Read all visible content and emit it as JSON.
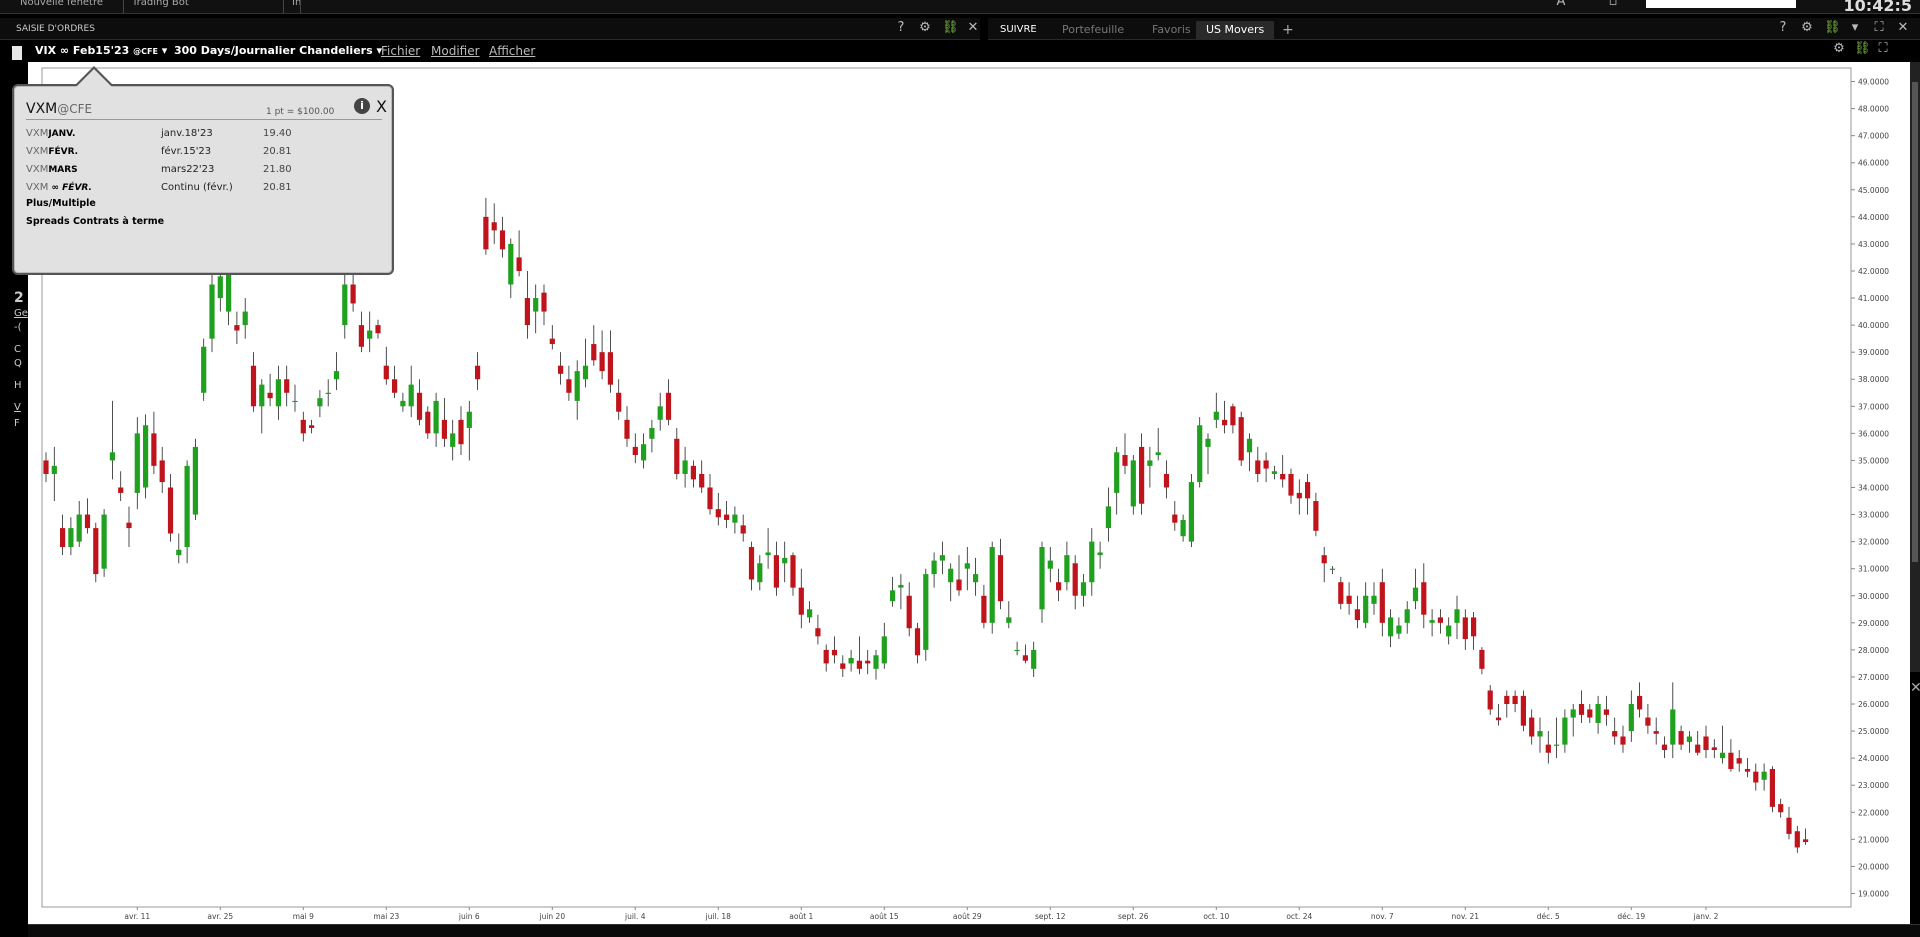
{
  "topbar": {
    "buttons": [
      "Nouvelle fenêtre",
      "Trading Bot",
      "Infos"
    ],
    "clock": "10:42:5"
  },
  "order_panel": {
    "title": "SAISIE D'ORDRES"
  },
  "tabs": [
    {
      "label": "SUIVRE",
      "active": false
    },
    {
      "label": "Portefeuille",
      "active": false
    },
    {
      "label": "Favoris",
      "active": false
    },
    {
      "label": "US Movers",
      "active": true
    }
  ],
  "chart_toolbar": {
    "symbol": "VIX ∞ Feb15'23",
    "exchange": "@CFE",
    "period": "300 Days/Journalier Chandeliers",
    "menus": [
      "Fichier",
      "Modifier",
      "Afficher"
    ]
  },
  "popup": {
    "title": "VXM",
    "exchange": "@CFE",
    "point_value": "1 pt = $100.00",
    "rows": [
      {
        "root": "VXM",
        "month": "JANV.",
        "expiry": "janv.18'23",
        "price": "19.40"
      },
      {
        "root": "VXM",
        "month": "FÉVR.",
        "expiry": "févr.15'23",
        "price": "20.81"
      },
      {
        "root": "VXM",
        "month": "MARS",
        "expiry": "mars22'23",
        "price": "21.80"
      },
      {
        "root": "VXM",
        "month": "∞ FÉVR.",
        "expiry": "Continu (févr.)",
        "price": "20.81"
      }
    ],
    "links": [
      "Plus/Multiple",
      "Spreads Contrats à terme"
    ]
  },
  "left_labels": [
    "2",
    "Ge",
    "-(",
    "C",
    "Q",
    "H",
    "V",
    "F"
  ],
  "chart_data": {
    "type": "candlestick",
    "y_ticks": [
      "49.0000",
      "48.0000",
      "47.0000",
      "46.0000",
      "45.0000",
      "44.0000",
      "43.0000",
      "42.0000",
      "41.0000",
      "40.0000",
      "39.0000",
      "38.0000",
      "37.0000",
      "36.0000",
      "35.0000",
      "34.0000",
      "33.0000",
      "32.0000",
      "31.0000",
      "30.0000",
      "29.0000",
      "28.0000",
      "27.0000",
      "26.0000",
      "25.0000",
      "24.0000",
      "23.0000",
      "22.0000",
      "21.0000",
      "20.0000",
      "19.0000"
    ],
    "ylim": [
      18.5,
      49.5
    ],
    "x_labels": [
      {
        "label": "avr. 11",
        "index": 11
      },
      {
        "label": "avr. 25",
        "index": 21
      },
      {
        "label": "mai 9",
        "index": 31
      },
      {
        "label": "mai 23",
        "index": 41
      },
      {
        "label": "juin 6",
        "index": 51
      },
      {
        "label": "juin 20",
        "index": 61
      },
      {
        "label": "juil. 4",
        "index": 71
      },
      {
        "label": "juil. 18",
        "index": 81
      },
      {
        "label": "août 1",
        "index": 91
      },
      {
        "label": "août 15",
        "index": 101
      },
      {
        "label": "août 29",
        "index": 111
      },
      {
        "label": "sept. 12",
        "index": 121
      },
      {
        "label": "sept. 26",
        "index": 131
      },
      {
        "label": "oct. 10",
        "index": 141
      },
      {
        "label": "oct. 24",
        "index": 151
      },
      {
        "label": "nov. 7",
        "index": 161
      },
      {
        "label": "nov. 21",
        "index": 171
      },
      {
        "label": "déc. 5",
        "index": 181
      },
      {
        "label": "déc. 19",
        "index": 191
      },
      {
        "label": "janv. 2",
        "index": 200
      }
    ],
    "candles": [
      [
        35.0,
        35.3,
        34.2,
        34.5
      ],
      [
        34.5,
        35.5,
        33.5,
        34.8
      ],
      [
        32.5,
        33.0,
        31.5,
        31.8
      ],
      [
        31.8,
        32.9,
        31.5,
        32.5
      ],
      [
        32.0,
        33.5,
        31.8,
        33.0
      ],
      [
        33.0,
        33.6,
        32.3,
        32.5
      ],
      [
        32.5,
        32.7,
        30.5,
        30.8
      ],
      [
        31.0,
        33.2,
        30.7,
        33.0
      ],
      [
        35.0,
        37.2,
        34.3,
        35.3
      ],
      [
        34.0,
        34.6,
        33.5,
        33.8
      ],
      [
        32.7,
        33.3,
        31.8,
        32.5
      ],
      [
        33.8,
        36.6,
        33.2,
        36.0
      ],
      [
        34.0,
        36.7,
        33.6,
        36.3
      ],
      [
        36.0,
        36.8,
        34.5,
        34.8
      ],
      [
        35.0,
        35.5,
        33.8,
        34.2
      ],
      [
        34.0,
        34.5,
        32.0,
        32.3
      ],
      [
        31.5,
        32.3,
        31.2,
        31.7
      ],
      [
        31.8,
        35.0,
        31.2,
        34.8
      ],
      [
        33.0,
        35.8,
        32.8,
        35.5
      ],
      [
        37.5,
        39.5,
        37.2,
        39.2
      ],
      [
        39.5,
        42.0,
        39.0,
        41.5
      ],
      [
        41.0,
        42.2,
        40.5,
        41.8
      ],
      [
        40.5,
        42.5,
        40.0,
        42.0
      ],
      [
        40.0,
        40.5,
        39.3,
        39.8
      ],
      [
        40.0,
        41.0,
        39.5,
        40.5
      ],
      [
        38.5,
        39.0,
        36.8,
        37.0
      ],
      [
        37.0,
        38.0,
        36.0,
        37.8
      ],
      [
        37.5,
        38.2,
        37.0,
        37.3
      ],
      [
        37.0,
        38.5,
        36.5,
        38.0
      ],
      [
        38.0,
        38.5,
        37.0,
        37.5
      ],
      [
        37.2,
        37.8,
        36.8,
        37.2
      ],
      [
        36.5,
        36.8,
        35.7,
        36.0
      ],
      [
        36.3,
        36.5,
        36.0,
        36.2
      ],
      [
        37.0,
        37.6,
        36.6,
        37.3
      ],
      [
        37.5,
        38.0,
        37.0,
        37.5
      ],
      [
        38.0,
        39.0,
        37.6,
        38.3
      ],
      [
        40.0,
        42.0,
        39.5,
        41.5
      ],
      [
        41.5,
        42.5,
        40.5,
        40.8
      ],
      [
        40.0,
        40.5,
        39.0,
        39.2
      ],
      [
        39.5,
        40.5,
        39.0,
        39.8
      ],
      [
        40.0,
        40.2,
        39.5,
        39.7
      ],
      [
        38.5,
        39.2,
        37.8,
        38.0
      ],
      [
        38.0,
        38.5,
        37.3,
        37.5
      ],
      [
        37.0,
        37.5,
        36.8,
        37.2
      ],
      [
        37.0,
        38.5,
        36.6,
        37.8
      ],
      [
        37.5,
        38.0,
        36.3,
        36.5
      ],
      [
        36.8,
        37.0,
        35.8,
        36.0
      ],
      [
        36.0,
        37.5,
        35.5,
        37.2
      ],
      [
        36.5,
        37.3,
        35.5,
        35.8
      ],
      [
        35.5,
        36.5,
        35.0,
        36.0
      ],
      [
        36.5,
        37.0,
        35.2,
        35.6
      ],
      [
        36.2,
        37.2,
        35.0,
        36.8
      ],
      [
        38.5,
        39.0,
        37.6,
        38.0
      ],
      [
        44.0,
        44.7,
        42.6,
        42.8
      ],
      [
        43.8,
        44.5,
        43.0,
        43.5
      ],
      [
        43.5,
        44.0,
        42.5,
        42.8
      ],
      [
        41.5,
        43.2,
        41.0,
        43.0
      ],
      [
        42.5,
        43.5,
        41.8,
        42.0
      ],
      [
        41.0,
        42.0,
        39.5,
        40.0
      ],
      [
        40.5,
        41.5,
        39.7,
        41.0
      ],
      [
        41.2,
        41.5,
        40.0,
        40.5
      ],
      [
        39.5,
        40.0,
        39.1,
        39.3
      ],
      [
        38.5,
        39.0,
        37.8,
        38.2
      ],
      [
        38.0,
        38.5,
        37.2,
        37.5
      ],
      [
        37.2,
        38.7,
        36.5,
        38.3
      ],
      [
        38.0,
        39.5,
        37.7,
        38.5
      ],
      [
        39.3,
        40.0,
        38.5,
        38.7
      ],
      [
        39.0,
        39.8,
        38.0,
        38.3
      ],
      [
        39.0,
        39.8,
        37.5,
        37.8
      ],
      [
        37.5,
        38.0,
        36.5,
        36.8
      ],
      [
        36.5,
        37.0,
        35.5,
        35.8
      ],
      [
        35.5,
        36.0,
        34.9,
        35.2
      ],
      [
        35.0,
        36.0,
        34.7,
        35.6
      ],
      [
        35.8,
        36.5,
        35.3,
        36.2
      ],
      [
        36.5,
        37.5,
        36.1,
        37.0
      ],
      [
        37.5,
        38.0,
        36.3,
        36.5
      ],
      [
        35.8,
        36.2,
        34.3,
        34.5
      ],
      [
        34.5,
        35.5,
        34.0,
        35.0
      ],
      [
        34.8,
        35.0,
        34.0,
        34.3
      ],
      [
        34.5,
        35.0,
        33.8,
        34.0
      ],
      [
        34.0,
        34.5,
        33.0,
        33.2
      ],
      [
        33.2,
        33.8,
        32.6,
        32.9
      ],
      [
        33.0,
        33.5,
        32.5,
        32.8
      ],
      [
        32.7,
        33.3,
        32.3,
        33.0
      ],
      [
        32.6,
        33.0,
        32.0,
        32.3
      ],
      [
        31.8,
        32.0,
        30.2,
        30.6
      ],
      [
        30.5,
        31.5,
        30.2,
        31.2
      ],
      [
        31.5,
        32.5,
        31.0,
        31.6
      ],
      [
        31.5,
        32.0,
        30.0,
        30.3
      ],
      [
        31.2,
        32.0,
        30.5,
        31.4
      ],
      [
        31.5,
        31.6,
        30.0,
        30.3
      ],
      [
        30.3,
        31.0,
        28.8,
        29.3
      ],
      [
        29.2,
        29.8,
        29.0,
        29.5
      ],
      [
        28.8,
        29.3,
        28.2,
        28.5
      ],
      [
        28.0,
        28.2,
        27.2,
        27.5
      ],
      [
        28.0,
        28.5,
        27.5,
        27.8
      ],
      [
        27.5,
        27.8,
        27.0,
        27.3
      ],
      [
        27.5,
        28.0,
        27.2,
        27.7
      ],
      [
        27.6,
        28.5,
        27.1,
        27.3
      ],
      [
        27.6,
        28.0,
        27.1,
        27.5
      ],
      [
        27.3,
        28.0,
        26.9,
        27.8
      ],
      [
        27.5,
        29.0,
        27.3,
        28.5
      ],
      [
        29.8,
        30.7,
        29.6,
        30.2
      ],
      [
        30.3,
        30.8,
        29.5,
        30.4
      ],
      [
        30.0,
        30.5,
        28.5,
        28.8
      ],
      [
        28.8,
        29.0,
        27.5,
        27.8
      ],
      [
        28.0,
        31.0,
        27.6,
        30.8
      ],
      [
        30.8,
        31.6,
        30.3,
        31.3
      ],
      [
        31.3,
        32.0,
        30.8,
        31.5
      ],
      [
        30.5,
        31.2,
        29.8,
        31.0
      ],
      [
        30.6,
        31.5,
        30.0,
        30.2
      ],
      [
        31.0,
        31.8,
        30.2,
        31.2
      ],
      [
        30.5,
        31.4,
        30.0,
        30.8
      ],
      [
        30.0,
        30.4,
        28.8,
        29.0
      ],
      [
        29.0,
        32.0,
        28.6,
        31.8
      ],
      [
        31.5,
        32.1,
        29.5,
        29.8
      ],
      [
        29.0,
        29.8,
        28.8,
        29.2
      ],
      [
        28.0,
        28.3,
        27.8,
        28.0
      ],
      [
        27.8,
        28.2,
        27.5,
        27.6
      ],
      [
        27.3,
        28.3,
        27.0,
        28.0
      ],
      [
        29.5,
        32.0,
        29.0,
        31.8
      ],
      [
        31.0,
        31.8,
        30.5,
        31.3
      ],
      [
        30.5,
        31.0,
        29.8,
        30.2
      ],
      [
        30.5,
        32.0,
        30.2,
        31.5
      ],
      [
        31.2,
        31.5,
        29.5,
        30.0
      ],
      [
        30.0,
        30.8,
        29.6,
        30.5
      ],
      [
        30.5,
        32.5,
        30.0,
        32.0
      ],
      [
        31.5,
        32.0,
        31.0,
        31.6
      ],
      [
        32.5,
        34.0,
        32.0,
        33.3
      ],
      [
        33.8,
        35.5,
        33.0,
        35.3
      ],
      [
        35.2,
        36.0,
        34.5,
        34.8
      ],
      [
        33.3,
        35.2,
        33.0,
        35.0
      ],
      [
        35.5,
        36.0,
        33.0,
        33.4
      ],
      [
        34.8,
        35.5,
        34.0,
        35.0
      ],
      [
        35.2,
        36.2,
        35.0,
        35.3
      ],
      [
        34.5,
        35.0,
        33.6,
        34.0
      ],
      [
        33.0,
        33.5,
        32.4,
        32.7
      ],
      [
        32.2,
        33.0,
        32.0,
        32.8
      ],
      [
        32.0,
        34.5,
        31.8,
        34.2
      ],
      [
        34.2,
        36.6,
        34.0,
        36.3
      ],
      [
        35.5,
        36.0,
        34.5,
        35.8
      ],
      [
        36.5,
        37.5,
        36.2,
        36.8
      ],
      [
        36.5,
        37.2,
        36.0,
        36.3
      ],
      [
        37.0,
        37.1,
        36.0,
        36.3
      ],
      [
        36.6,
        36.8,
        34.8,
        35.0
      ],
      [
        35.3,
        36.0,
        34.6,
        35.8
      ],
      [
        35.0,
        35.5,
        34.2,
        34.5
      ],
      [
        35.0,
        35.3,
        34.2,
        34.7
      ],
      [
        34.5,
        34.8,
        34.3,
        34.6
      ],
      [
        34.5,
        35.2,
        34.0,
        34.3
      ],
      [
        34.5,
        34.7,
        33.4,
        33.7
      ],
      [
        33.8,
        34.3,
        33.0,
        33.6
      ],
      [
        34.2,
        34.5,
        33.0,
        33.6
      ],
      [
        33.5,
        33.8,
        32.2,
        32.4
      ],
      [
        31.5,
        31.8,
        30.5,
        31.2
      ],
      [
        31.0,
        31.1,
        30.8,
        31.0
      ],
      [
        30.5,
        30.7,
        29.5,
        29.7
      ],
      [
        30.0,
        30.5,
        29.3,
        29.7
      ],
      [
        29.5,
        30.0,
        28.8,
        29.1
      ],
      [
        29.0,
        30.5,
        28.8,
        30.0
      ],
      [
        29.7,
        30.5,
        29.3,
        30.0
      ],
      [
        30.5,
        31.0,
        28.5,
        29.0
      ],
      [
        28.5,
        29.5,
        28.1,
        29.2
      ],
      [
        28.6,
        29.2,
        28.4,
        28.9
      ],
      [
        29.0,
        29.8,
        28.6,
        29.5
      ],
      [
        29.8,
        31.0,
        29.5,
        30.3
      ],
      [
        30.5,
        31.2,
        28.8,
        29.3
      ],
      [
        29.0,
        29.5,
        28.5,
        29.1
      ],
      [
        29.2,
        29.5,
        28.6,
        29.0
      ],
      [
        28.5,
        29.2,
        28.2,
        28.9
      ],
      [
        29.0,
        30.0,
        28.4,
        29.5
      ],
      [
        29.2,
        29.5,
        28.0,
        28.4
      ],
      [
        29.2,
        29.4,
        28.0,
        28.5
      ],
      [
        28.0,
        28.1,
        27.1,
        27.3
      ],
      [
        26.5,
        26.7,
        25.6,
        25.8
      ],
      [
        25.5,
        26.0,
        25.2,
        25.4
      ],
      [
        26.3,
        26.5,
        25.5,
        26.0
      ],
      [
        26.3,
        26.5,
        25.7,
        26.0
      ],
      [
        26.3,
        26.5,
        25.0,
        25.2
      ],
      [
        25.5,
        25.8,
        24.5,
        24.8
      ],
      [
        24.8,
        25.5,
        24.2,
        25.0
      ],
      [
        24.5,
        25.0,
        23.8,
        24.2
      ],
      [
        24.5,
        25.5,
        24.0,
        24.5
      ],
      [
        24.5,
        25.8,
        24.2,
        25.5
      ],
      [
        25.5,
        26.0,
        24.8,
        25.8
      ],
      [
        26.0,
        26.5,
        25.3,
        25.6
      ],
      [
        25.8,
        26.0,
        25.3,
        25.5
      ],
      [
        25.3,
        26.3,
        24.9,
        26.0
      ],
      [
        25.8,
        26.3,
        25.2,
        25.6
      ],
      [
        25.0,
        25.5,
        24.5,
        24.8
      ],
      [
        24.8,
        25.2,
        24.2,
        24.5
      ],
      [
        25.0,
        26.5,
        24.6,
        26.0
      ],
      [
        26.3,
        26.8,
        25.5,
        25.8
      ],
      [
        25.5,
        26.0,
        24.9,
        25.2
      ],
      [
        25.0,
        25.5,
        24.5,
        24.9
      ],
      [
        24.5,
        24.8,
        24.0,
        24.3
      ],
      [
        24.5,
        26.8,
        24.0,
        25.8
      ],
      [
        25.0,
        25.2,
        24.3,
        24.5
      ],
      [
        24.6,
        25.0,
        24.2,
        24.8
      ],
      [
        24.5,
        25.0,
        24.1,
        24.2
      ],
      [
        24.8,
        25.2,
        24.0,
        24.3
      ],
      [
        24.4,
        24.7,
        24.0,
        24.3
      ],
      [
        24.0,
        25.2,
        23.8,
        24.2
      ],
      [
        24.2,
        24.7,
        23.5,
        23.6
      ],
      [
        24.0,
        24.3,
        23.5,
        23.8
      ],
      [
        23.6,
        24.0,
        23.3,
        23.5
      ],
      [
        23.5,
        23.8,
        22.8,
        23.1
      ],
      [
        23.2,
        23.8,
        22.8,
        23.5
      ],
      [
        23.6,
        23.7,
        22.0,
        22.2
      ],
      [
        22.3,
        22.5,
        21.8,
        22.0
      ],
      [
        21.8,
        22.2,
        21.0,
        21.2
      ],
      [
        21.3,
        21.5,
        20.5,
        20.7
      ],
      [
        21.0,
        21.4,
        20.8,
        20.9
      ]
    ]
  }
}
